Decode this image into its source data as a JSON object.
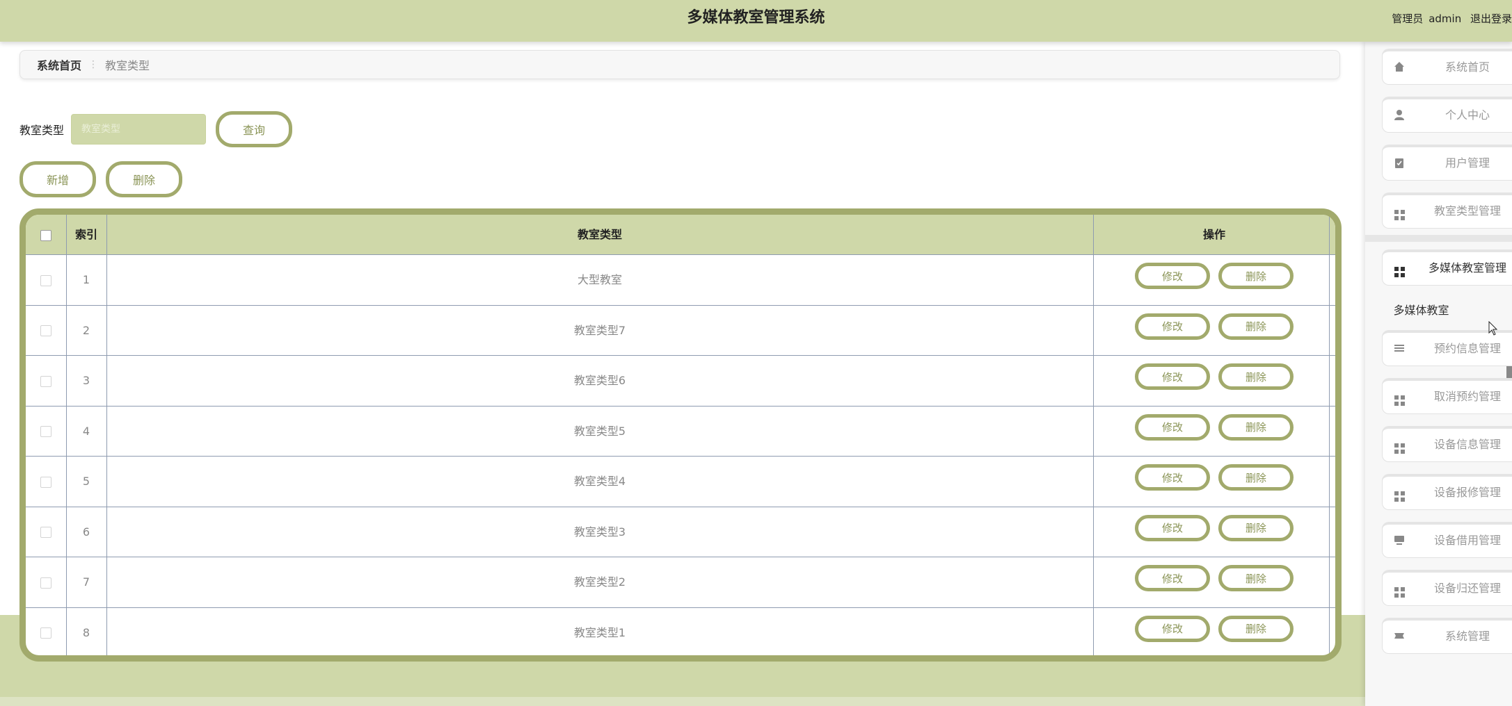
{
  "header": {
    "title": "多媒体教室管理系统",
    "role": "管理员",
    "username": "admin",
    "logout": "退出登录"
  },
  "breadcrumb": {
    "home": "系统首页",
    "current": "教室类型"
  },
  "search": {
    "label": "教室类型",
    "placeholder": "教室类型",
    "query_button": "查询"
  },
  "actions": {
    "add": "新增",
    "delete": "删除"
  },
  "table": {
    "headers": {
      "index": "索引",
      "type": "教室类型",
      "ops": "操作"
    },
    "edit_label": "修改",
    "delete_label": "删除",
    "rows": [
      {
        "index": "1",
        "type": "大型教室"
      },
      {
        "index": "2",
        "type": "教室类型7"
      },
      {
        "index": "3",
        "type": "教室类型6"
      },
      {
        "index": "4",
        "type": "教室类型5"
      },
      {
        "index": "5",
        "type": "教室类型4"
      },
      {
        "index": "6",
        "type": "教室类型3"
      },
      {
        "index": "7",
        "type": "教室类型2"
      },
      {
        "index": "8",
        "type": "教室类型1"
      }
    ]
  },
  "sidebar": {
    "items": [
      {
        "label": "系统首页",
        "icon": "home-icon"
      },
      {
        "label": "个人中心",
        "icon": "user-icon"
      },
      {
        "label": "用户管理",
        "icon": "clipboard-icon"
      },
      {
        "label": "教室类型管理",
        "icon": "grid-icon"
      },
      {
        "label": "多媒体教室管理",
        "icon": "grid-icon"
      },
      {
        "label": "预约信息管理",
        "icon": "list-icon"
      },
      {
        "label": "取消预约管理",
        "icon": "grid-icon"
      },
      {
        "label": "设备信息管理",
        "icon": "grid-icon"
      },
      {
        "label": "设备报修管理",
        "icon": "grid-icon"
      },
      {
        "label": "设备借用管理",
        "icon": "monitor-icon"
      },
      {
        "label": "设备归还管理",
        "icon": "grid-icon"
      },
      {
        "label": "系统管理",
        "icon": "ticket-icon"
      }
    ],
    "sub_item": "多媒体教室"
  },
  "colors": {
    "accent": "#a2aa6c",
    "header_bg": "#cfd8a9",
    "button_text": "#8a9456"
  }
}
